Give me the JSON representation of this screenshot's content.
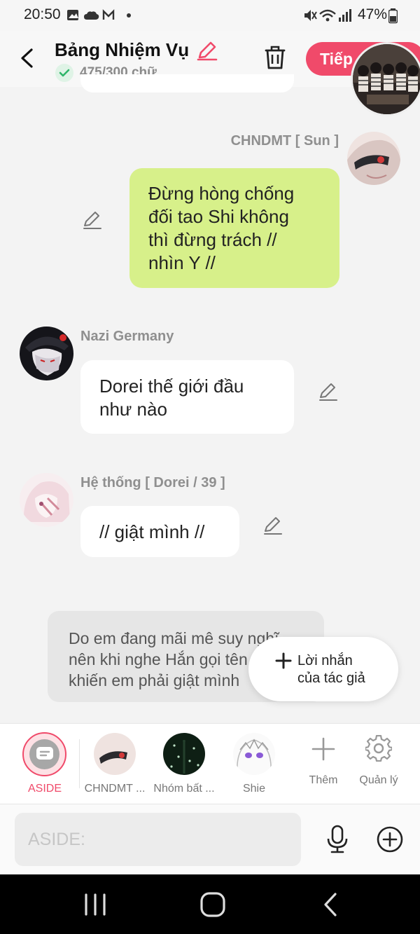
{
  "status": {
    "time": "20:50",
    "battery": "47%"
  },
  "header": {
    "title": "Bảng Nhiệm Vụ",
    "word_count": "475/300 chữ",
    "continue_label": "Tiếp"
  },
  "messages": [
    {
      "sender": "CHNDMT [ Sun ]",
      "text_lines": [
        "Đừng hòng chống",
        "đối tao Shi không",
        "thì đừng trách //",
        "nhìn Y //"
      ]
    },
    {
      "sender": "Nazi Germany",
      "text_lines": [
        "Dorei thế giới đầu",
        "như nào"
      ]
    },
    {
      "sender": "Hệ thống [ Dorei / 39 ]",
      "text_lines": [
        "// giật mình //"
      ]
    }
  ],
  "aside_text_lines": [
    "Do em đang mãi mê suy nghĩ",
    "nên khi nghe Hắn gọi tên",
    "khiến em phải giật mình"
  ],
  "author_note": {
    "line1": "Lời nhắn",
    "line2": "của tác giả"
  },
  "characters": [
    {
      "label": "ASIDE",
      "active": true
    },
    {
      "label": "CHNDMT ..."
    },
    {
      "label": "Nhóm bất ..."
    },
    {
      "label": "Shie"
    },
    {
      "label": "Thêm"
    },
    {
      "label": "Quản lý"
    }
  ],
  "input": {
    "placeholder": "ASIDE:"
  },
  "colors": {
    "accent": "#f04a6a",
    "bubble_green": "#d7f08a",
    "check_green": "#2fb56a"
  }
}
